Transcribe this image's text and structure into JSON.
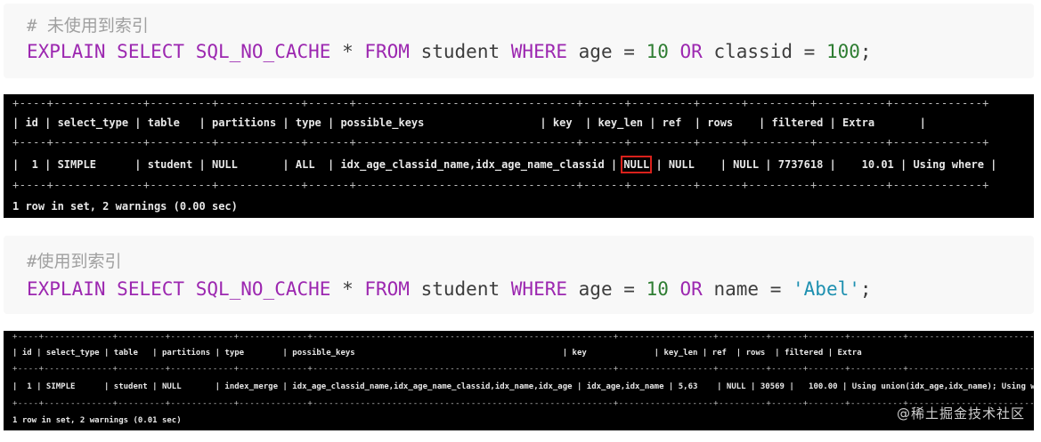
{
  "block1": {
    "comment": "# 未使用到索引",
    "sql": {
      "explain": "EXPLAIN",
      "select": "SELECT",
      "nocache": "SQL_NO_CACHE",
      "star": "*",
      "from": "FROM",
      "table": "student",
      "where": "WHERE",
      "col1": "age",
      "eq1": "=",
      "val1": "10",
      "or": "OR",
      "col2": "classid",
      "eq2": "=",
      "val2": "100",
      "end": ";"
    }
  },
  "terminal1": {
    "border": "+----+-------------+---------+------------+------+--------------------------------+------+---------+------+---------+----------+-------------+",
    "header": "| id | select_type | table   | partitions | type | possible_keys                  | key  | key_len | ref  | rows    | filtered | Extra       |",
    "row_pre": "|  1 | SIMPLE      | student | NULL       | ALL  | idx_age_classid_name,idx_age_name_classid | ",
    "row_key": "NULL",
    "row_post": " | NULL    | NULL | 7737618 |    10.01 | Using where |",
    "footer": "1 row in set, 2 warnings (0.00 sec)"
  },
  "block2": {
    "comment": "#使用到索引",
    "sql": {
      "explain": "EXPLAIN",
      "select": "SELECT",
      "nocache": "SQL_NO_CACHE",
      "star": "*",
      "from": "FROM",
      "table": "student",
      "where": "WHERE",
      "col1": "age",
      "eq1": "=",
      "val1": "10",
      "or": "OR",
      "col2": "name",
      "eq2": "=",
      "val2": "'Abel'",
      "end": ";"
    }
  },
  "terminal2": {
    "border": "+----+-------------+---------+------------+-------------+---------------------------------------------------------+------------------+---------+------+-------+----------+------------------------------------------------+",
    "header": "| id | select_type | table   | partitions | type        | possible_keys                                           | key              | key_len | ref  | rows  | filtered | Extra                                          |",
    "row": "|  1 | SIMPLE      | student | NULL       | index_merge | idx_age_classid_name,idx_age_name_classid,idx_name,idx_age | idx_age,idx_name | 5,63    | NULL | 30569 |   100.00 | Using union(idx_age,idx_name); Using where |",
    "footer": "1 row in set, 2 warnings (0.01 sec)"
  },
  "watermark": "@稀土掘金技术社区"
}
